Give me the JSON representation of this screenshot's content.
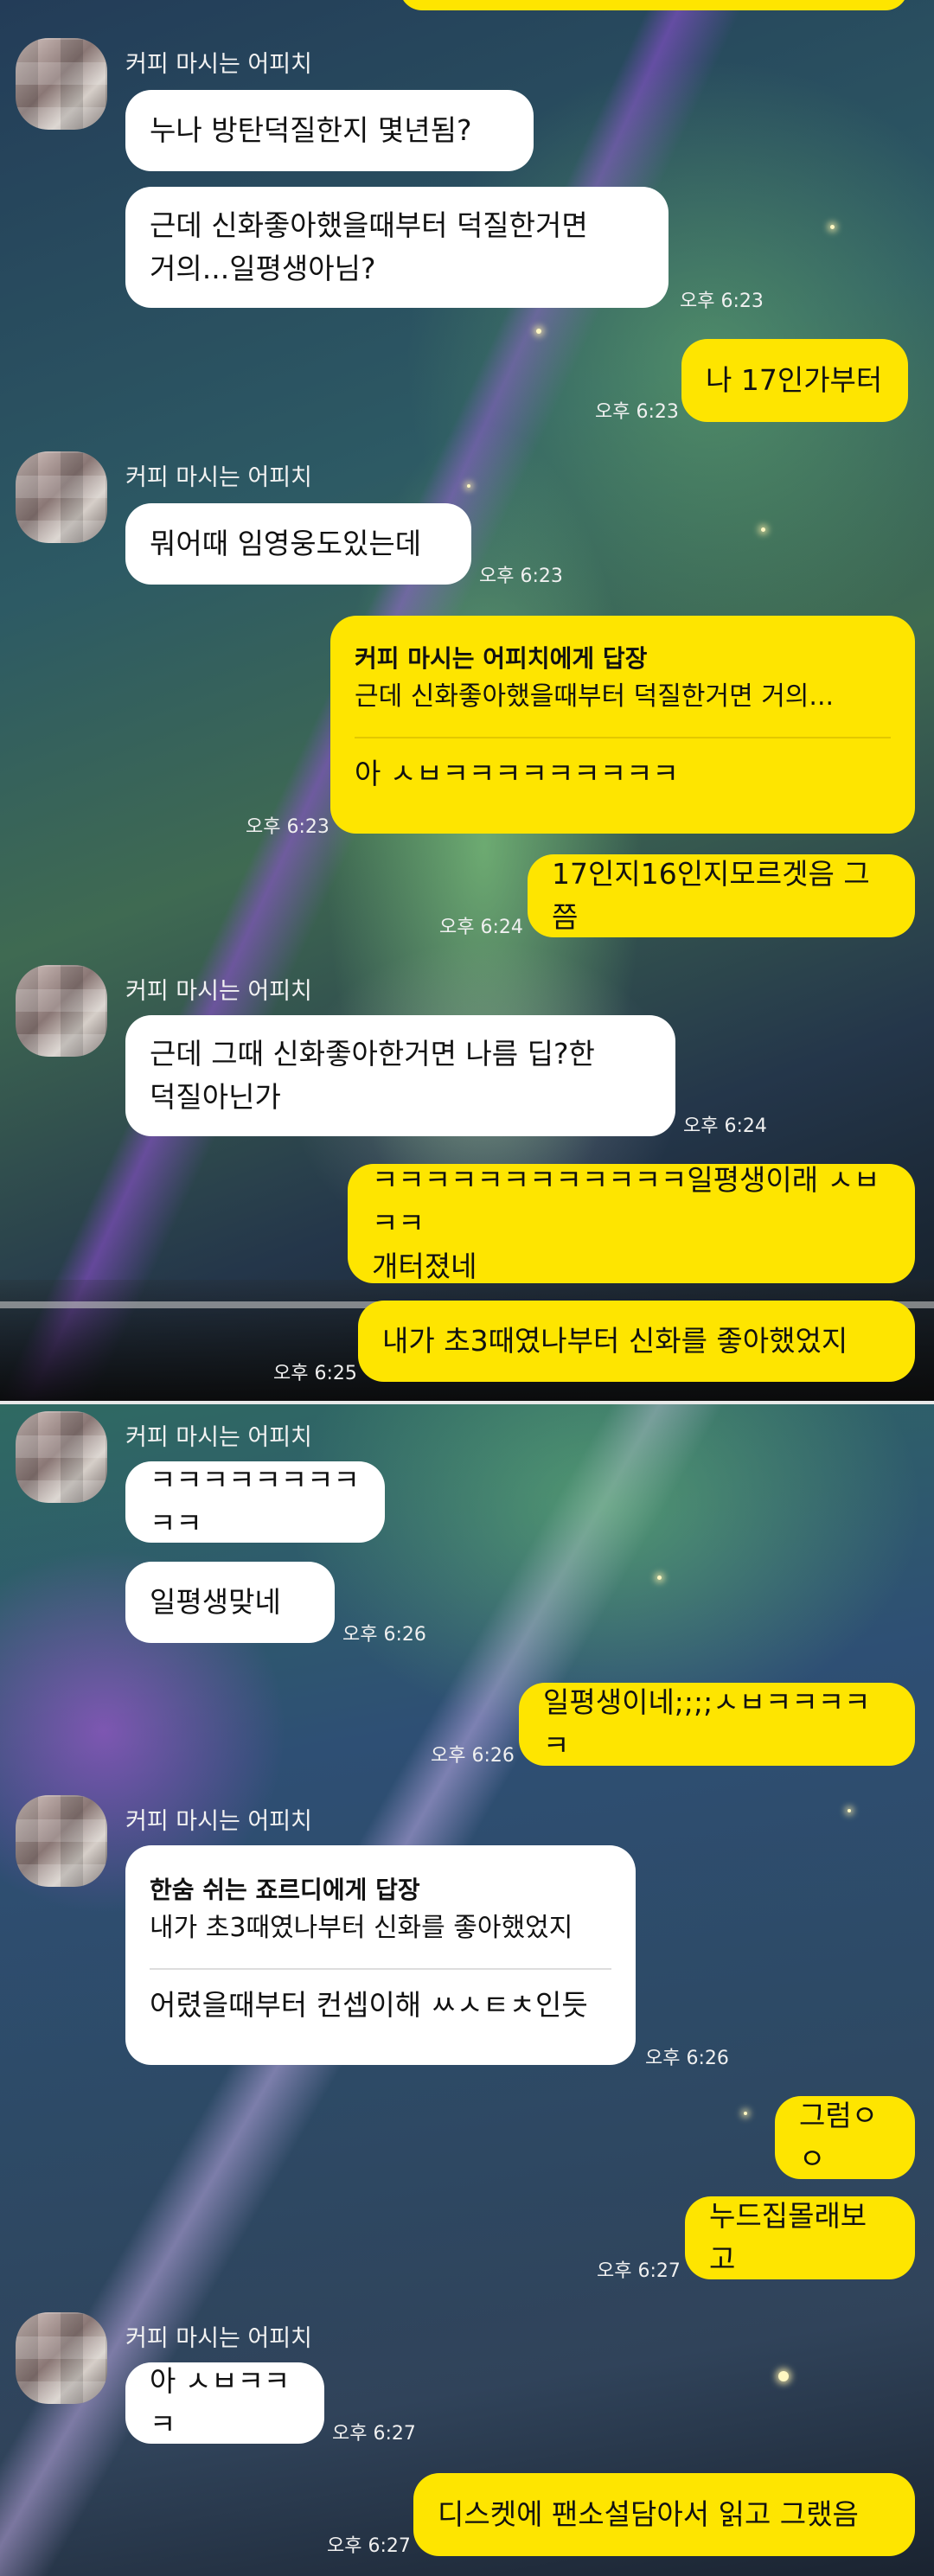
{
  "chat": {
    "sender_name": "커피 마시는 어피치",
    "time_623": "오후 6:23",
    "time_624": "오후 6:24",
    "time_625": "오후 6:25",
    "time_626": "오후 6:26",
    "time_627": "오후 6:27",
    "messages": {
      "m1": "누나 방탄덕질한지 몇년됨?",
      "m2": "근데 신화좋아했을때부터 덕질한거면\n거의...일평생아님?",
      "m3": "나 17인가부터",
      "m4": "뭐어때 임영웅도있는데",
      "m5_quote_head": "커피 마시는 어피치에게 답장",
      "m5_quote_text": "근데 신화좋아했을때부터 덕질한거면 거의...",
      "m5_reply": "아 ㅅㅂㅋㅋㅋㅋㅋㅋㅋㅋㅋ",
      "m6": "17인지16인지모르겟음 그쯤",
      "m7": "근데 그때 신화좋아한거면 나름 딥?한\n덕질아닌가",
      "m8": "ㅋㅋㅋㅋㅋㅋㅋㅋㅋㅋㅋㅋ일평생이래 ㅅㅂㅋㅋ\n개터졌네",
      "m9": "내가 초3때였나부터 신화를 좋아했었지",
      "m10": "ㅋㅋㅋㅋㅋㅋㅋㅋㅋㅋ",
      "m11": "일평생맞네",
      "m12": "일평생이네;;;;ㅅㅂㅋㅋㅋㅋㅋ",
      "m13_quote_head": "한숨 쉬는 죠르디에게 답장",
      "m13_quote_text": "내가 초3때였나부터 신화를 좋아했었지",
      "m13_reply": "어렸을때부터 컨셉이해 ㅆㅅㅌㅊ인듯",
      "m14": "그럼ㅇㅇ",
      "m15": "누드집몰래보고",
      "m16": "아 ㅅㅂㅋㅋㅋ",
      "m17": "디스켓에 팬소설담아서 읽고 그랬음"
    }
  },
  "colors": {
    "my_bubble": "#fee500",
    "their_bubble": "#ffffff"
  }
}
